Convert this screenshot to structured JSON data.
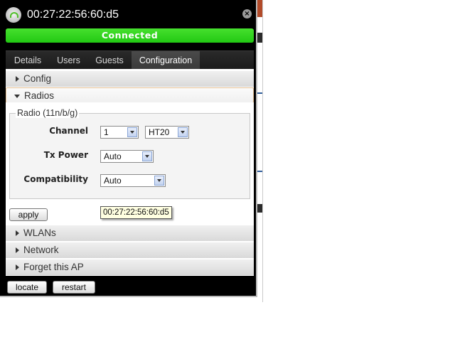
{
  "window": {
    "title": "00:27:22:56:60:d5",
    "status": "Connected"
  },
  "tabs": [
    {
      "label": "Details",
      "active": false
    },
    {
      "label": "Users",
      "active": false
    },
    {
      "label": "Guests",
      "active": false
    },
    {
      "label": "Configuration",
      "active": true
    }
  ],
  "sections": {
    "config": "Config",
    "radios": "Radios",
    "wlans": "WLANs",
    "network": "Network",
    "forget": "Forget this AP"
  },
  "radio": {
    "legend": "Radio (11n/b/g)",
    "channel_label": "Channel",
    "channel_value": "1",
    "width_value": "HT20",
    "tx_power_label": "Tx Power",
    "tx_power_value": "Auto",
    "compat_label": "Compatibility",
    "compat_value": "Auto"
  },
  "buttons": {
    "apply": "apply",
    "locate": "locate",
    "restart": "restart"
  },
  "tooltip": "00:27:22:56:60:d5",
  "colors": {
    "status_green": "#22c813",
    "accent_border": "#e4bf92"
  }
}
